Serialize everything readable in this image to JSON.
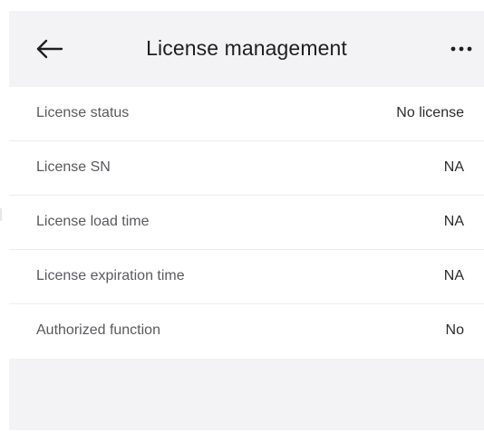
{
  "header": {
    "title": "License management",
    "back_icon": "arrow-left-icon",
    "more_icon": "more-horizontal-icon"
  },
  "rows": [
    {
      "label": "License status",
      "value": "No license"
    },
    {
      "label": "License SN",
      "value": "NA"
    },
    {
      "label": "License load time",
      "value": "NA"
    },
    {
      "label": "License expiration time",
      "value": "NA"
    },
    {
      "label": "Authorized function",
      "value": "No"
    }
  ],
  "colors": {
    "header_bg": "#f3f3f5",
    "row_bg": "#ffffff",
    "label_text": "#5a5a5e",
    "value_text": "#2b2b2b"
  }
}
